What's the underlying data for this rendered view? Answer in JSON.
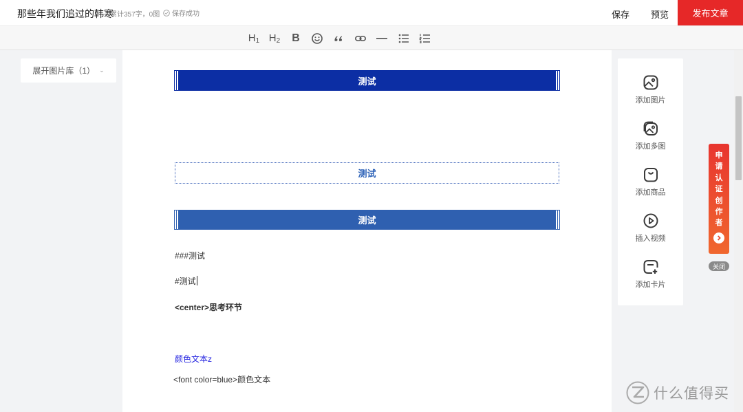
{
  "header": {
    "title": "那些年我们追过的韩寒",
    "meta": "累计357字，0图",
    "save_status": "保存成功",
    "save_label": "保存",
    "preview_label": "预览",
    "publish_label": "发布文章"
  },
  "toolbar": {
    "h1_label": "H",
    "h1_sub": "1",
    "h2_label": "H",
    "h2_sub": "2",
    "bold_label": "B"
  },
  "library": {
    "label": "展开图片库（1）"
  },
  "editor": {
    "blocks": [
      {
        "text": "测试",
        "style": "solid-dark-blue"
      },
      {
        "text": "测试",
        "style": "dotted-outline"
      },
      {
        "text": "测试",
        "style": "solid-blue"
      }
    ],
    "paragraphs": [
      "###测试",
      "#测试",
      "<center>思考环节",
      "颜色文本z",
      "<font color=blue>颜色文本"
    ]
  },
  "insert_panel": {
    "items": [
      {
        "label": "添加图片",
        "icon": "image-icon"
      },
      {
        "label": "添加多图",
        "icon": "images-icon"
      },
      {
        "label": "添加商品",
        "icon": "shopping-bag-icon"
      },
      {
        "label": "插入视频",
        "icon": "play-icon"
      },
      {
        "label": "添加卡片",
        "icon": "card-add-icon"
      }
    ]
  },
  "cert_promo": {
    "text": "申请认证创作者",
    "close_label": "关闭"
  },
  "watermark": {
    "text": "什么值得买"
  },
  "colors": {
    "publish": "#e62828",
    "block_dark_blue": "#0c2ea4",
    "block_blue": "#2f60b0",
    "color_text": "#2424e0"
  }
}
